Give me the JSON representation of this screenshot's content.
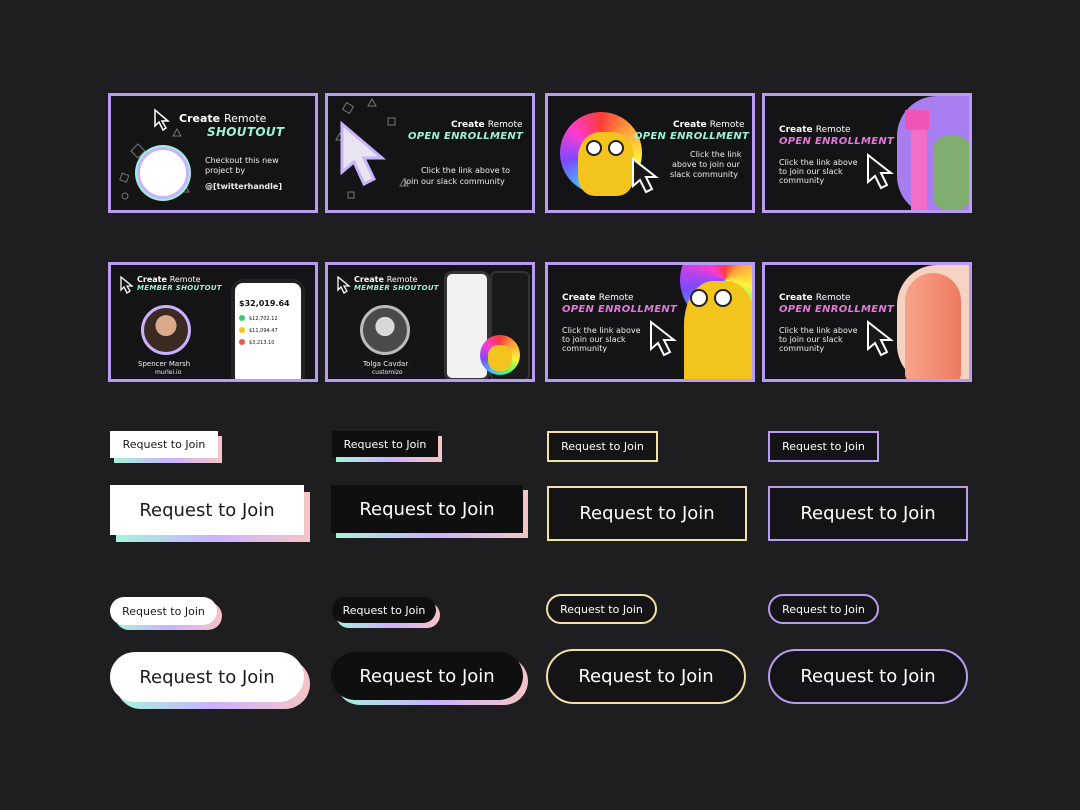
{
  "cards": {
    "c1": {
      "create": "Create",
      "remote": "Remote",
      "heading": "SHOUTOUT",
      "body_line1": "Checkout this new",
      "body_line2": "project by",
      "handle": "@[twitterhandle]"
    },
    "c2": {
      "create": "Create",
      "remote": "Remote",
      "heading": "OPEN ENROLLMENT",
      "body_line1": "Click the link above to",
      "body_line2": "join our slack community"
    },
    "c3": {
      "create": "Create",
      "remote": "Remote",
      "heading": "OPEN ENROLLMENT",
      "body_line1": "Click the link",
      "body_line2": "above to join our",
      "body_line3": "slack community"
    },
    "c4": {
      "create": "Create",
      "remote": "Remote",
      "heading": "OPEN ENROLLMENT",
      "body_line1": "Click the link above",
      "body_line2": "to join our slack",
      "body_line3": "community"
    },
    "c5": {
      "create": "Create",
      "remote": "Remote",
      "heading": "MEMBER SHOUTOUT",
      "name": "Spencer Marsh",
      "company": "murlei.io",
      "balance": "$32,019.64",
      "row1": "$12,702.12",
      "row2": "$11,094.47",
      "row3": "$3,213.10"
    },
    "c6": {
      "create": "Create",
      "remote": "Remote",
      "heading": "MEMBER SHOUTOUT",
      "name": "Tolga Cavdar",
      "company": "customizo"
    },
    "c7": {
      "create": "Create",
      "remote": "Remote",
      "heading": "OPEN ENROLLMENT",
      "body_line1": "Click the link above",
      "body_line2": "to join our slack",
      "body_line3": "community"
    },
    "c8": {
      "create": "Create",
      "remote": "Remote",
      "heading": "OPEN ENROLLMENT",
      "body_line1": "Click the link above",
      "body_line2": "to join our slack",
      "body_line3": "community"
    }
  },
  "buttons": {
    "label": "Request to Join"
  },
  "colors": {
    "border": "#b79cf1",
    "mint": "#9df3d8",
    "pink": "#e27ad8",
    "gold": "#f1e0a8"
  },
  "icons": [
    "cursor-arrow-icon",
    "rainbow-character-icon",
    "robot-figure-icon",
    "hand-icon",
    "phone-mockup-icon",
    "avatar-photo-icon"
  ]
}
